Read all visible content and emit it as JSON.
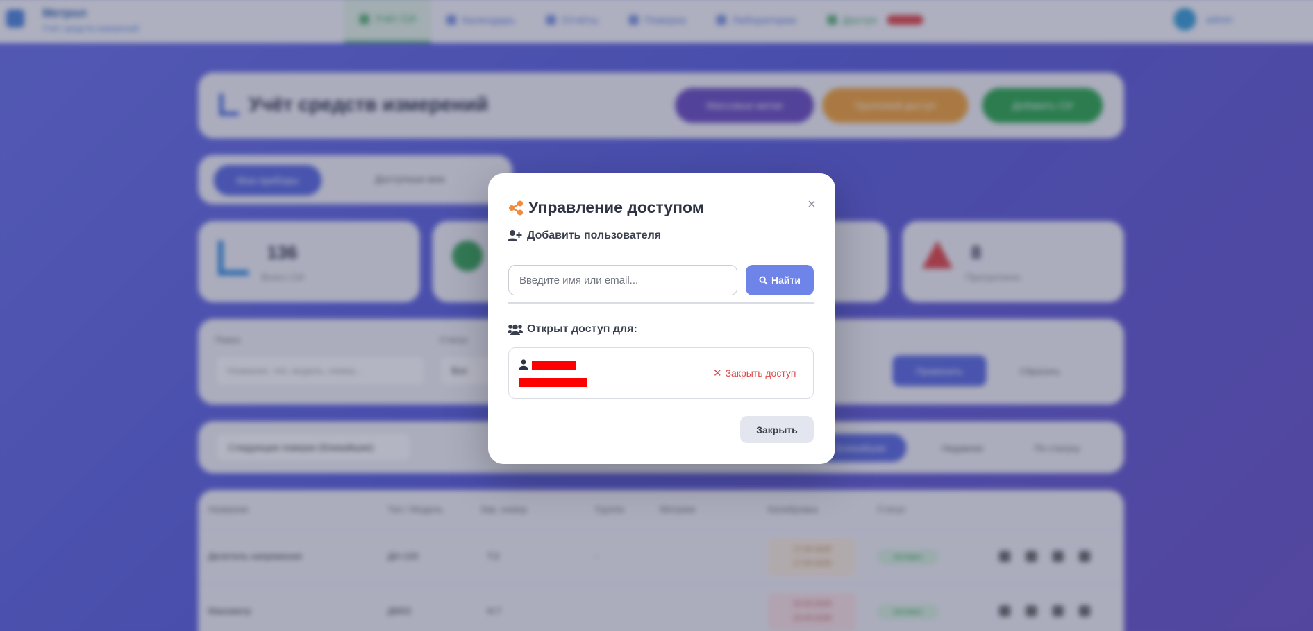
{
  "app": {
    "brand_title": "Метрол",
    "brand_subtitle": "Учёт средств измерений",
    "nav": [
      {
        "label": "Учёт СИ"
      },
      {
        "label": "Календарь"
      },
      {
        "label": "Отчёты"
      },
      {
        "label": "Поверка"
      },
      {
        "label": "Лаборатории"
      },
      {
        "label": "Доступ"
      }
    ],
    "nav_badge": "",
    "user_name": "admin",
    "page_title": "Учёт средств измерений",
    "header_buttons": [
      "Массовые метки",
      "Групповой доступ",
      "Добавить СИ"
    ],
    "tabs": [
      "Мои приборы",
      "Доступные мне"
    ],
    "stats": [
      {
        "value": "136",
        "label": "Всего СИ"
      },
      {
        "value": "",
        "label": ""
      },
      {
        "value": "",
        "label": ""
      },
      {
        "value": "8",
        "label": "Просрочено"
      }
    ],
    "filters": {
      "search_label": "Поиск",
      "search_placeholder": "Название, тип, модель, номер...",
      "status_label": "Статус",
      "status_value": "Все",
      "apply": "Применить",
      "reset": "Сбросить"
    },
    "toolbar": {
      "select": "Следующие поверки (ближайшие)",
      "segments": [
        "Ближайшие",
        "Недавние",
        "По статусу"
      ]
    },
    "table": {
      "headers": [
        "Название",
        "Тип / Модель",
        "Зав. номер",
        "Группа",
        "Метрики",
        "Калибровка",
        "Статус"
      ],
      "rows": [
        {
          "name": "Делитель напряжения",
          "model": "ДН-100",
          "serial": "Т.2",
          "group": "-",
          "date1": "17.05.2025",
          "date2": "17.05.2026",
          "status": "Активен"
        },
        {
          "name": "Манометр",
          "model": "ДМ02",
          "serial": "Н.7",
          "group": "",
          "date1": "10.03.2025",
          "date2": "10.03.2026",
          "status": "Активен"
        }
      ]
    }
  },
  "modal": {
    "title": "Управление доступом",
    "close_symbol": "×",
    "add_section": "Добавить пользователя",
    "search_placeholder": "Введите имя или email...",
    "find_button": "Найти",
    "access_section": "Открыт доступ для:",
    "revoke_label": "Закрыть доступ",
    "revoke_symbol": "✕",
    "close_button": "Закрыть",
    "colors": {
      "accent": "#6f84e8",
      "share_icon": "#f08a3c",
      "danger": "#e04a4a",
      "redaction": "#ff0000"
    }
  }
}
